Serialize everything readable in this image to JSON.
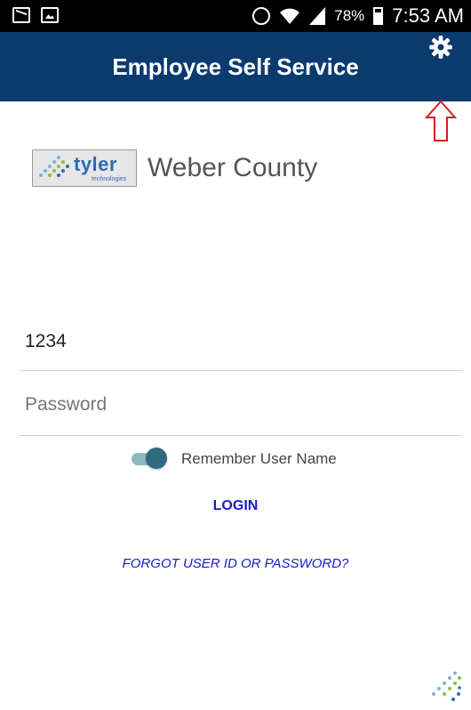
{
  "status_bar": {
    "battery_percent": "78%",
    "time": "7:53 AM",
    "icons": [
      "message-icon",
      "image-icon",
      "alarm-icon",
      "wifi-icon",
      "signal-icon",
      "battery-icon"
    ]
  },
  "app_bar": {
    "title": "Employee Self Service",
    "settings_icon": "gear-icon",
    "background_color": "#0b3a6e"
  },
  "annotation": {
    "arrow_icon": "up-arrow-icon",
    "arrow_color": "#d62020"
  },
  "branding": {
    "logo_word": "tyler",
    "logo_subtext": "technologies",
    "organization": "Weber County"
  },
  "login_form": {
    "user_id_value": "1234",
    "password_placeholder": "Password",
    "remember_label": "Remember User Name",
    "remember_on": true,
    "login_label": "LOGIN",
    "forgot_label": "FORGOT USER ID OR PASSWORD?",
    "link_color": "#1a1acc"
  }
}
